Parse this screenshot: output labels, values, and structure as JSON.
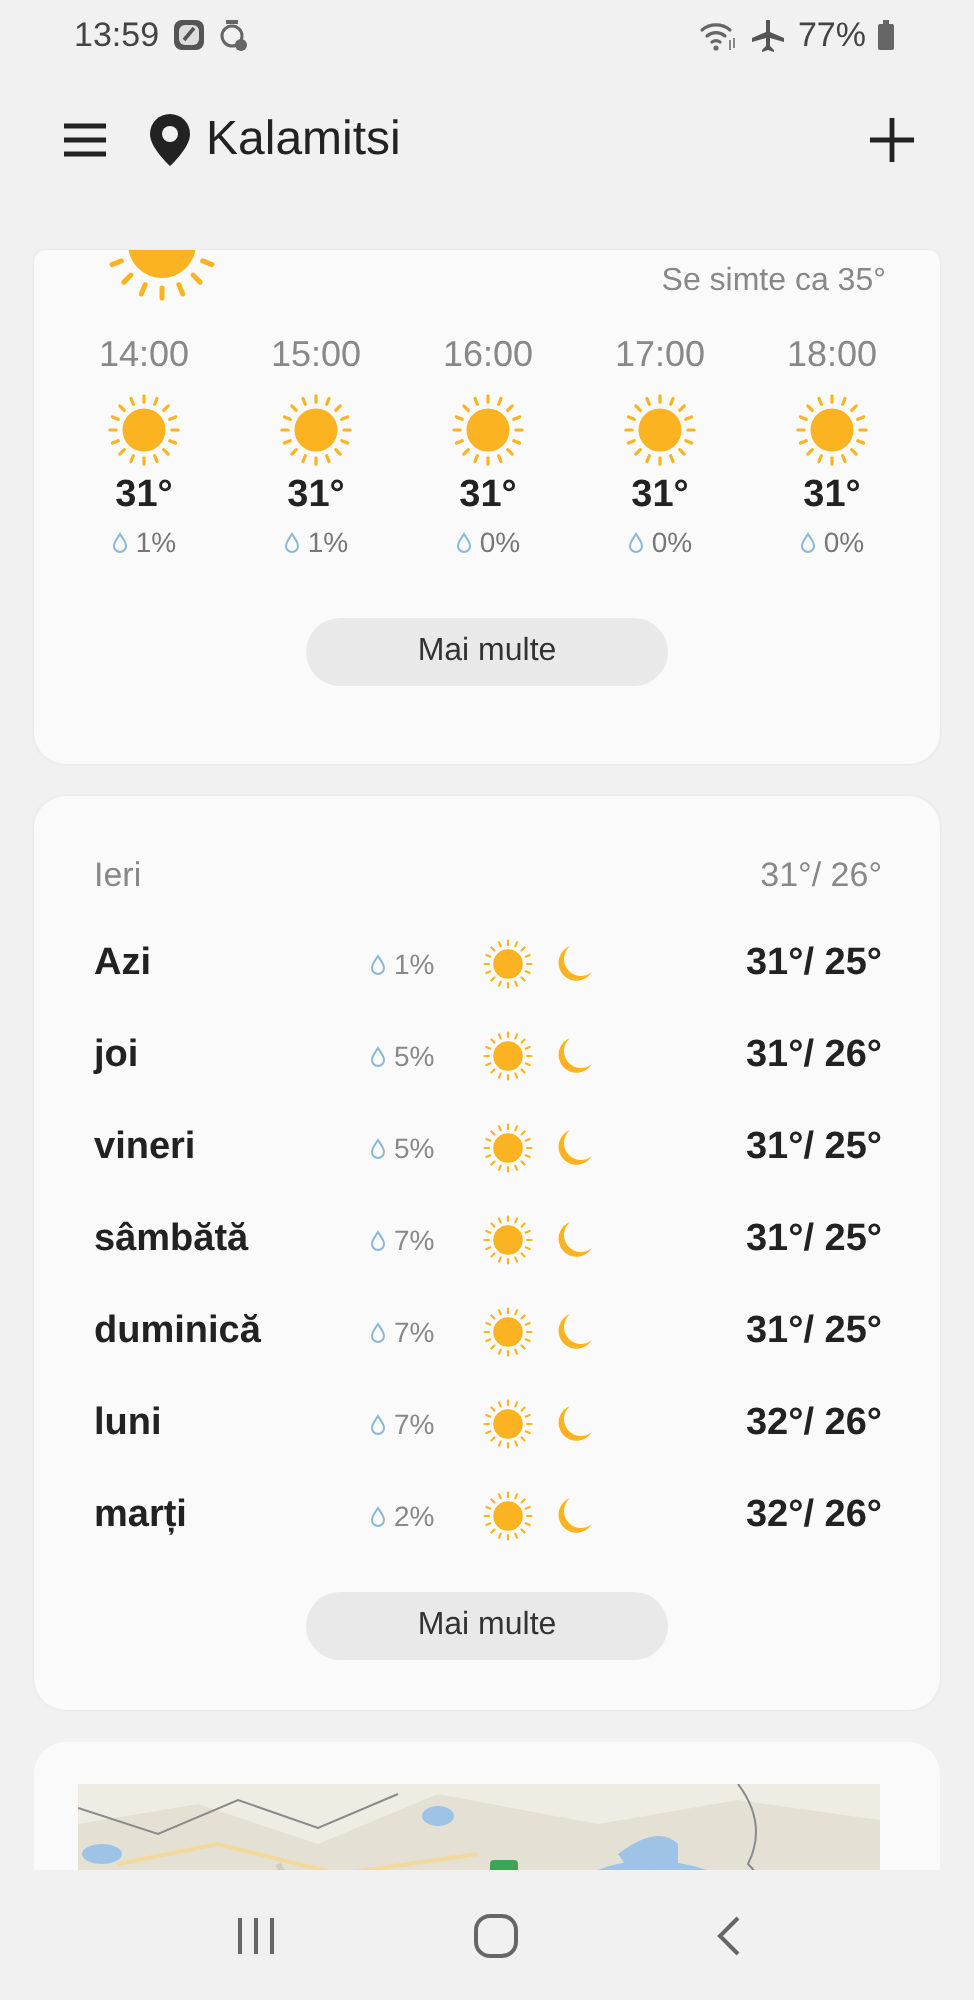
{
  "status_bar": {
    "time": "13:59",
    "battery": "77%"
  },
  "header": {
    "location": "Kalamitsi"
  },
  "current": {
    "feels_like": "Se simte ca 35°"
  },
  "hourly": [
    {
      "time": "14:00",
      "temp": "31°",
      "precip": "1%"
    },
    {
      "time": "15:00",
      "temp": "31°",
      "precip": "1%"
    },
    {
      "time": "16:00",
      "temp": "31°",
      "precip": "0%"
    },
    {
      "time": "17:00",
      "temp": "31°",
      "precip": "0%"
    },
    {
      "time": "18:00",
      "temp": "31°",
      "precip": "0%"
    }
  ],
  "hourly_more": "Mai multe",
  "daily": {
    "yesterday": {
      "label": "Ieri",
      "temps": "31°/ 26°"
    },
    "days": [
      {
        "day": "Azi",
        "precip": "1%",
        "temps": "31°/ 25°"
      },
      {
        "day": "joi",
        "precip": "5%",
        "temps": "31°/ 26°"
      },
      {
        "day": "vineri",
        "precip": "5%",
        "temps": "31°/ 25°"
      },
      {
        "day": "sâmbătă",
        "precip": "7%",
        "temps": "31°/ 25°"
      },
      {
        "day": "duminică",
        "precip": "7%",
        "temps": "31°/ 25°"
      },
      {
        "day": "luni",
        "precip": "7%",
        "temps": "32°/ 26°"
      },
      {
        "day": "marți",
        "precip": "2%",
        "temps": "32°/ 26°"
      }
    ],
    "more": "Mai multe"
  }
}
